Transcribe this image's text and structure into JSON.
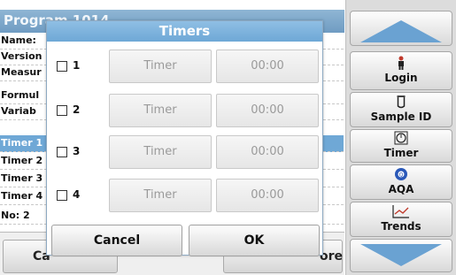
{
  "background": {
    "title": "Program 1014",
    "rows": [
      "Name:",
      "Version",
      "Measur",
      "Formul",
      "Variab",
      "Timer 1",
      "Timer 2",
      "Timer 3",
      "Timer 4",
      "No: 2"
    ],
    "selected_row": 5,
    "left_button_label": "Ca",
    "right_button_label": "ore"
  },
  "dialog": {
    "title": "Timers",
    "timers": [
      {
        "number": "1",
        "name": "Timer",
        "time": "00:00"
      },
      {
        "number": "2",
        "name": "Timer",
        "time": "00:00"
      },
      {
        "number": "3",
        "name": "Timer",
        "time": "00:00"
      },
      {
        "number": "4",
        "name": "Timer",
        "time": "00:00"
      }
    ],
    "cancel_label": "Cancel",
    "ok_label": "OK"
  },
  "sidebar": {
    "login_label": "Login",
    "sample_id_label": "Sample ID",
    "timer_label": "Timer",
    "aqa_label": "AQA",
    "trends_label": "Trends"
  },
  "colors": {
    "accent_blue": "#6ea8d6",
    "title_bar": "#6f9cc2",
    "selected_row": "#6fa8d6"
  }
}
